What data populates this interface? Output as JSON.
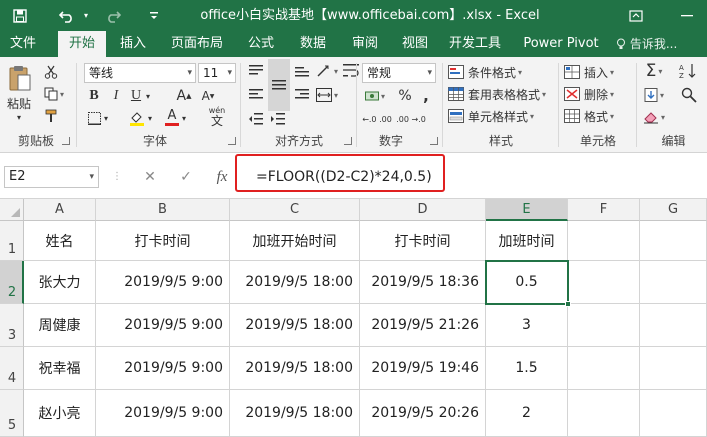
{
  "window": {
    "title": "office小白实战基地【www.officebai.com】.xlsx - Excel",
    "quick_access": {
      "save_icon": "save-icon",
      "undo_icon": "undo-icon",
      "redo_icon": "redo-icon",
      "customize_icon": "customize-icon"
    },
    "controls": {
      "ribbon_display_icon": "ribbon-display-icon",
      "minimize_icon": "minimize-icon"
    }
  },
  "ribbon_tabs": [
    "文件",
    "开始",
    "插入",
    "页面布局",
    "公式",
    "数据",
    "审阅",
    "视图",
    "开发工具",
    "Power Pivot"
  ],
  "tell_me": "告诉我...",
  "ribbon": {
    "clipboard": {
      "paste": "粘贴",
      "label": "剪贴板"
    },
    "font": {
      "name": "等线",
      "size": "11",
      "bold": "B",
      "italic": "I",
      "underline": "U",
      "grow": "A",
      "shrink": "A",
      "font_color": "A",
      "phonetic_top": "wén",
      "phonetic_bottom": "文",
      "label": "字体"
    },
    "alignment": {
      "label": "对齐方式"
    },
    "number": {
      "format": "常规",
      "percent": "%",
      "comma": ",",
      "inc_decimal": "←.0 .00",
      "dec_decimal": ".00 →.0",
      "label": "数字"
    },
    "styles": {
      "conditional": "条件格式",
      "table": "套用表格格式",
      "cell_styles": "单元格样式",
      "label": "样式"
    },
    "cells": {
      "insert": "插入",
      "delete": "删除",
      "format": "格式",
      "label": "单元格"
    },
    "editing": {
      "sum": "Σ",
      "label": "编辑"
    }
  },
  "formula_bar": {
    "name_box": "E2",
    "cancel": "✕",
    "enter": "✓",
    "fx": "fx",
    "formula": "=FLOOR((D2-C2)*24,0.5)"
  },
  "sheet": {
    "columns": [
      "A",
      "B",
      "C",
      "D",
      "E",
      "F",
      "G"
    ],
    "row_numbers": [
      "1",
      "2",
      "3",
      "4",
      "5"
    ],
    "header_row": [
      "姓名",
      "打卡时间",
      "加班开始时间",
      "打卡时间",
      "加班时间",
      "",
      ""
    ],
    "rows": [
      [
        "张大力",
        "2019/9/5 9:00",
        "2019/9/5 18:00",
        "2019/9/5 18:36",
        "0.5",
        "",
        ""
      ],
      [
        "周健康",
        "2019/9/5 9:00",
        "2019/9/5 18:00",
        "2019/9/5 21:26",
        "3",
        "",
        ""
      ],
      [
        "祝幸福",
        "2019/9/5 9:00",
        "2019/9/5 18:00",
        "2019/9/5 19:46",
        "1.5",
        "",
        ""
      ],
      [
        "赵小亮",
        "2019/9/5 9:00",
        "2019/9/5 18:00",
        "2019/9/5 20:26",
        "2",
        "",
        ""
      ]
    ],
    "selected_cell": "E2"
  }
}
